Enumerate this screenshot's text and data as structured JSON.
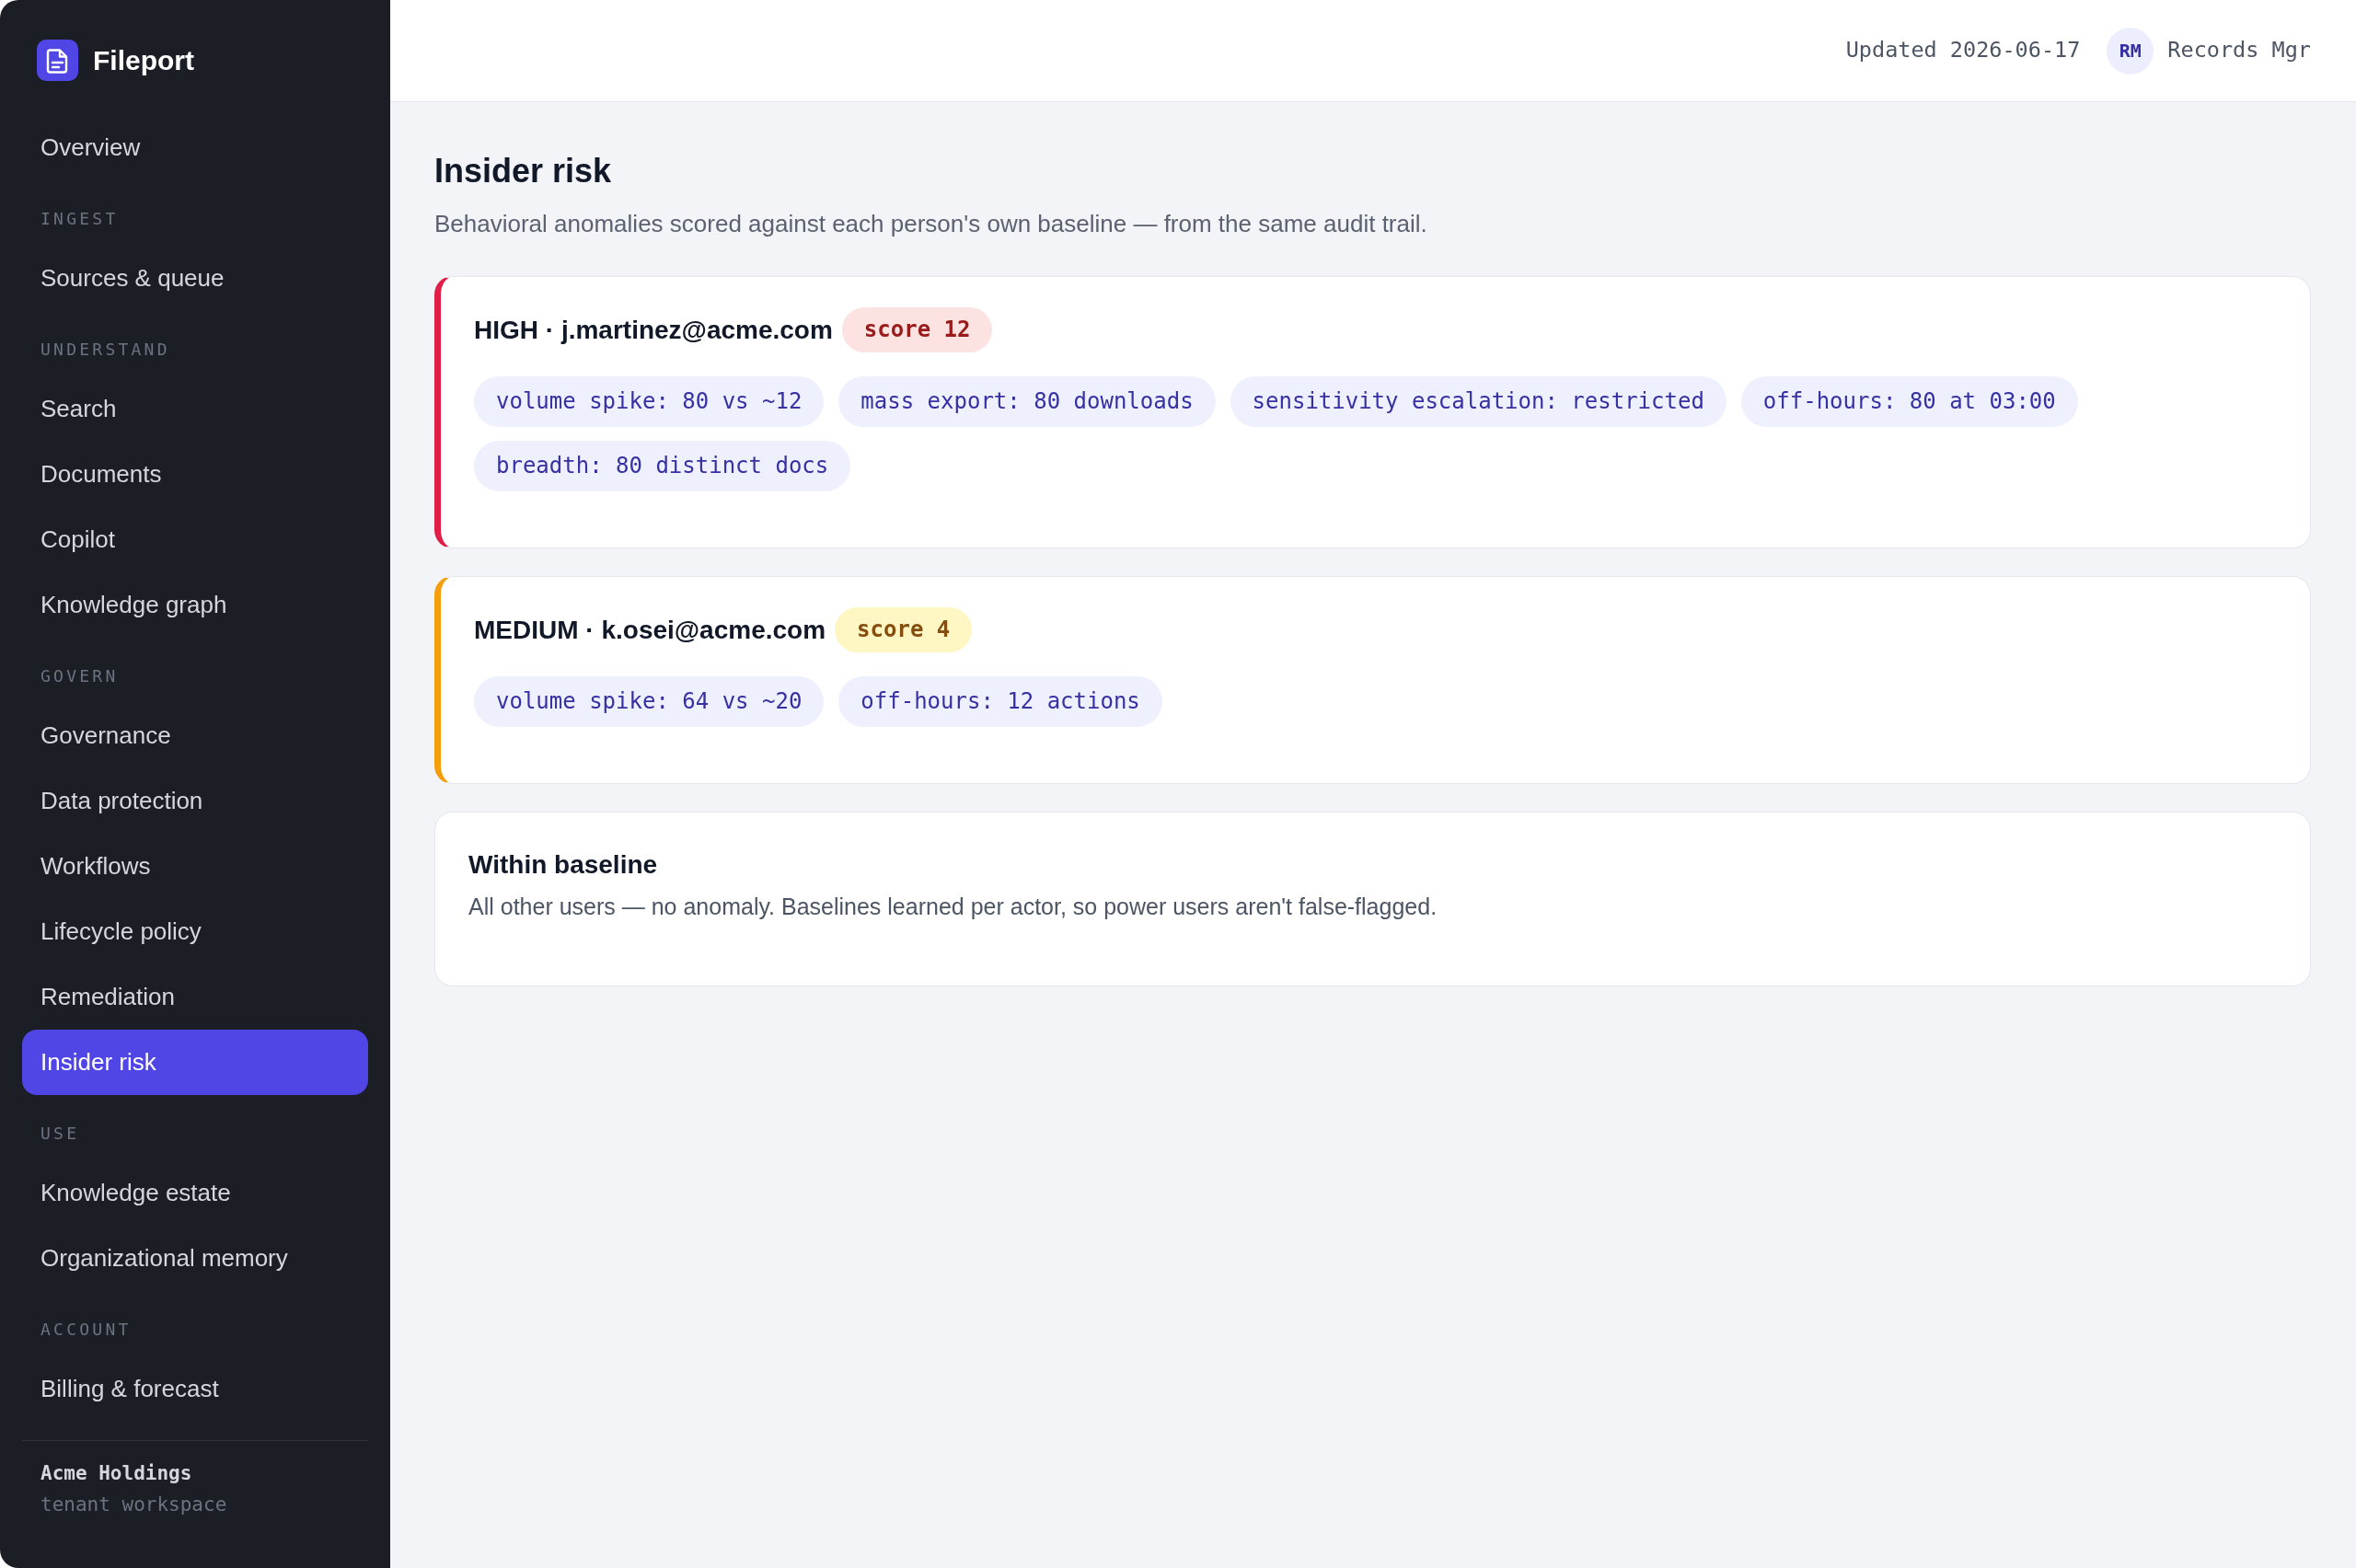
{
  "sidebar": {
    "brand": "Fileport",
    "sections": [
      {
        "items": [
          {
            "label": "Overview",
            "selected": false
          }
        ]
      },
      {
        "heading": "INGEST",
        "items": [
          {
            "label": "Sources & queue",
            "selected": false
          }
        ]
      },
      {
        "heading": "UNDERSTAND",
        "items": [
          {
            "label": "Search",
            "selected": false
          },
          {
            "label": "Documents",
            "selected": false
          },
          {
            "label": "Copilot",
            "selected": false
          },
          {
            "label": "Knowledge graph",
            "selected": false
          }
        ]
      },
      {
        "heading": "GOVERN",
        "items": [
          {
            "label": "Governance",
            "selected": false
          },
          {
            "label": "Data protection",
            "selected": false
          },
          {
            "label": "Workflows",
            "selected": false
          },
          {
            "label": "Lifecycle policy",
            "selected": false
          },
          {
            "label": "Remediation",
            "selected": false
          },
          {
            "label": "Insider risk",
            "selected": true
          }
        ]
      },
      {
        "heading": "USE",
        "items": [
          {
            "label": "Knowledge estate",
            "selected": false
          },
          {
            "label": "Organizational memory",
            "selected": false
          }
        ]
      },
      {
        "heading": "ACCOUNT",
        "items": [
          {
            "label": "Billing & forecast",
            "selected": false
          }
        ]
      }
    ],
    "tenant": {
      "name": "Acme Holdings",
      "note": "tenant workspace"
    }
  },
  "topbar": {
    "updated": "Updated 2026-06-17",
    "user": {
      "initials": "RM",
      "name": "Records Mgr"
    }
  },
  "page": {
    "title": "Insider risk",
    "subtitle": "Behavioral anomalies scored against each person's own baseline — from the same audit trail."
  },
  "cards": [
    {
      "kind": "high",
      "title": "HIGH · j.martinez@acme.com",
      "score": "score 12",
      "signals": [
        "volume spike: 80 vs ~12",
        "mass export: 80 downloads",
        "sensitivity escalation: restricted",
        "off-hours: 80 at 03:00",
        "breadth: 80 distinct docs"
      ]
    },
    {
      "kind": "medium",
      "title": "MEDIUM · k.osei@acme.com",
      "score": "score 4",
      "signals": [
        "volume spike: 64 vs ~20",
        "off-hours: 12 actions"
      ]
    },
    {
      "kind": "baseline",
      "title": "Within baseline",
      "text": "All other users — no anomaly. Baselines learned per actor, so power users aren't false-flagged."
    }
  ]
}
